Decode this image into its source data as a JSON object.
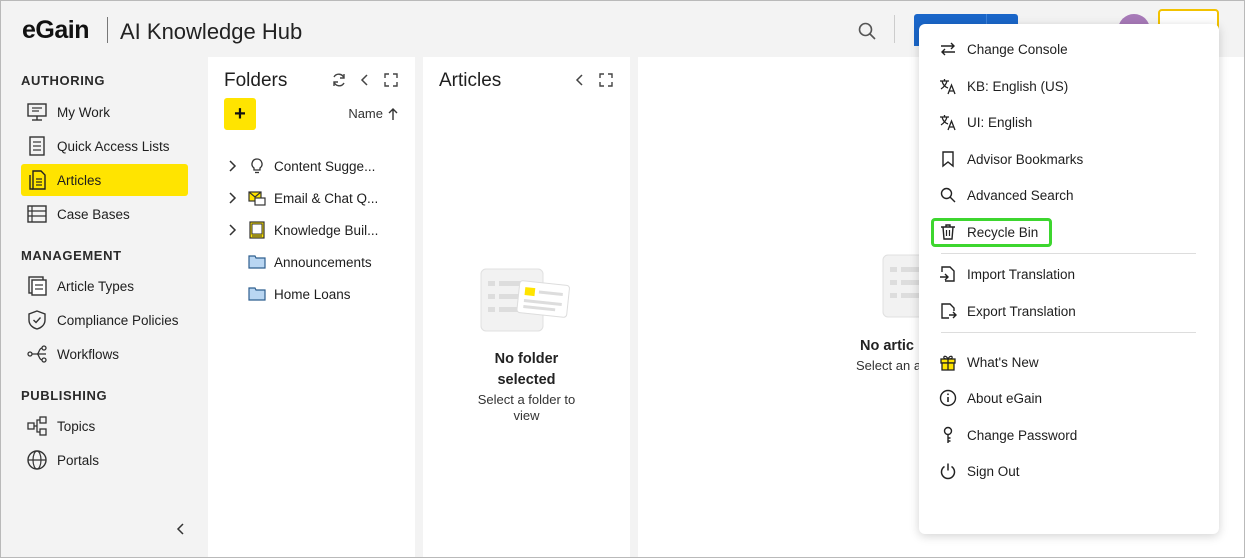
{
  "header": {
    "logo": "eGain",
    "app_title": "AI Knowledge Hub"
  },
  "nav": {
    "sections": [
      {
        "title": "AUTHORING",
        "items": [
          {
            "label": "My Work",
            "icon": "monitor-icon"
          },
          {
            "label": "Quick Access Lists",
            "icon": "list-icon"
          },
          {
            "label": "Articles",
            "icon": "articles-icon",
            "active": true
          },
          {
            "label": "Case Bases",
            "icon": "case-bases-icon"
          }
        ]
      },
      {
        "title": "MANAGEMENT",
        "items": [
          {
            "label": "Article Types",
            "icon": "article-types-icon"
          },
          {
            "label": "Compliance Policies",
            "icon": "shield-icon"
          },
          {
            "label": "Workflows",
            "icon": "workflow-icon"
          }
        ]
      },
      {
        "title": "PUBLISHING",
        "items": [
          {
            "label": "Topics",
            "icon": "topics-icon"
          },
          {
            "label": "Portals",
            "icon": "globe-icon"
          }
        ]
      }
    ]
  },
  "folders": {
    "title": "Folders",
    "add_label": "+",
    "sort_label": "Name",
    "tree": [
      {
        "label": "Content Sugge...",
        "icon": "lightbulb-icon",
        "expandable": true
      },
      {
        "label": "Email & Chat Q...",
        "icon": "email-chat-icon",
        "expandable": true
      },
      {
        "label": "Knowledge Buil...",
        "icon": "knowledge-base-icon",
        "expandable": true
      },
      {
        "label": "Announcements",
        "icon": "folder-icon",
        "expandable": false
      },
      {
        "label": "Home Loans",
        "icon": "folder-icon",
        "expandable": false
      }
    ]
  },
  "articles": {
    "title": "Articles",
    "empty_title_1": "No folder",
    "empty_title_2": "selected",
    "empty_sub_1": "Select a folder to",
    "empty_sub_2": "view"
  },
  "detail": {
    "empty_title": "No artic",
    "empty_sub": "Select an a"
  },
  "menu": {
    "items": [
      {
        "label": "Change Console",
        "icon": "swap-icon"
      },
      {
        "label": "KB: English (US)",
        "icon": "translate-icon"
      },
      {
        "label": "UI: English",
        "icon": "translate-icon"
      },
      {
        "label": "Advisor Bookmarks",
        "icon": "bookmark-icon"
      },
      {
        "label": "Advanced Search",
        "icon": "search-icon"
      },
      {
        "label": "Recycle Bin",
        "icon": "trash-icon",
        "highlighted": true
      },
      {
        "label": "Import Translation",
        "icon": "import-icon"
      },
      {
        "label": "Export Translation",
        "icon": "export-icon"
      },
      {
        "label": "What's New",
        "icon": "gift-icon"
      },
      {
        "label": "About eGain",
        "icon": "info-icon"
      },
      {
        "label": "Change Password",
        "icon": "key-icon"
      },
      {
        "label": "Sign Out",
        "icon": "power-icon"
      }
    ]
  },
  "colors": {
    "accent": "#ffe400",
    "primary_blue": "#1a66c9",
    "avatar": "#a77ab8",
    "highlight_border": "#3dd62f",
    "folder_blue": "#b9d6f2"
  }
}
